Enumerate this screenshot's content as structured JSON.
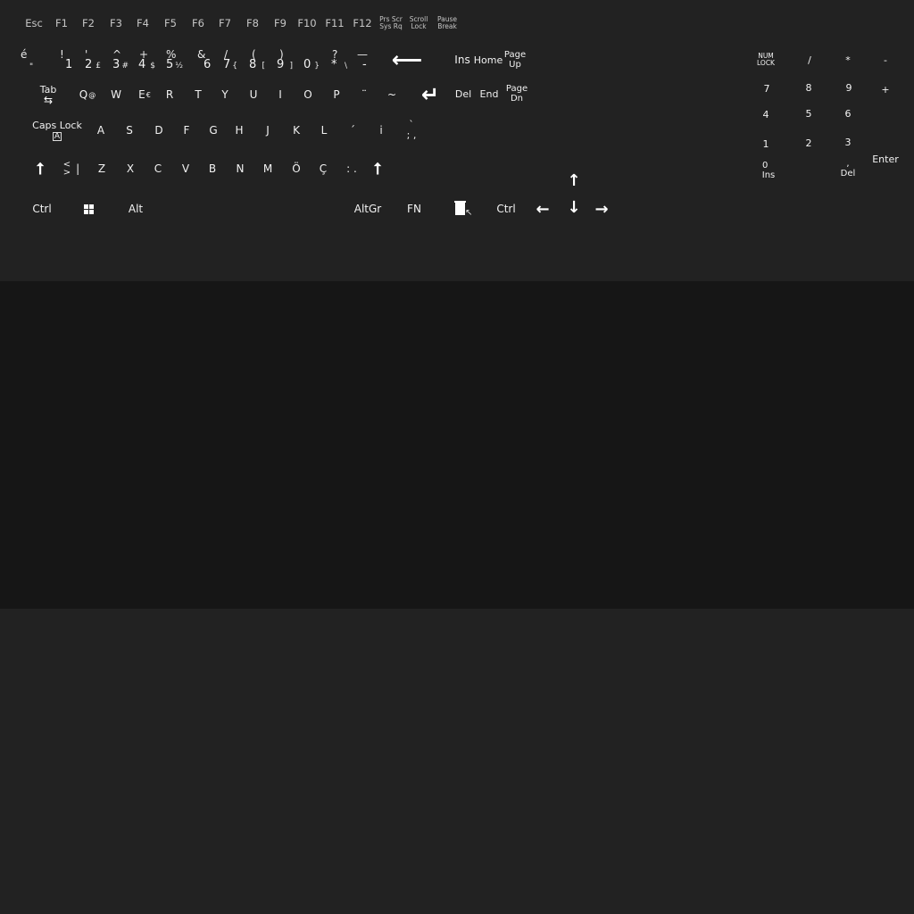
{
  "keyboard": {
    "function_row": {
      "esc": "Esc",
      "f1": "F1",
      "f2": "F2",
      "f3": "F3",
      "f4": "F4",
      "f5": "F5",
      "f6": "F6",
      "f7": "F7",
      "f8": "F8",
      "f9": "F9",
      "f10": "F10",
      "f11": "F11",
      "f12": "F12",
      "prtsc_line1": "Prs Scr",
      "prtsc_line2": "Sys Rq",
      "scroll_line1": "Scroll",
      "scroll_line2": "Lock",
      "pause_line1": "Pause",
      "pause_line2": "Break"
    },
    "number_row": [
      {
        "top": "é",
        "bottom": "\"",
        "alt": ""
      },
      {
        "top": "!",
        "bottom": "1",
        "alt": ""
      },
      {
        "top": "'",
        "bottom": "2",
        "alt": "£"
      },
      {
        "top": "^",
        "bottom": "3",
        "alt": "#"
      },
      {
        "top": "+",
        "bottom": "4",
        "alt": "$"
      },
      {
        "top": "%",
        "bottom": "5",
        "alt": "½"
      },
      {
        "top": "&",
        "bottom": "6",
        "alt": ""
      },
      {
        "top": "/",
        "bottom": "7",
        "alt": "{"
      },
      {
        "top": "(",
        "bottom": "8",
        "alt": "["
      },
      {
        "top": ")",
        "bottom": "9",
        "alt": "]"
      },
      {
        "top": "",
        "bottom": "0",
        "alt": "}"
      },
      {
        "top": "?",
        "bottom": "*",
        "alt": "\\"
      },
      {
        "top": "—",
        "bottom": "-",
        "alt": ""
      }
    ],
    "backspace_icon": "backspace-arrow",
    "nav": {
      "ins": "Ins",
      "home": "Home",
      "pageup_line1": "Page",
      "pageup_line2": "Up",
      "del": "Del",
      "end": "End",
      "pagedn_line1": "Page",
      "pagedn_line2": "Dn"
    },
    "qwerty_row": {
      "tab": "Tab",
      "keys": [
        {
          "main": "Q",
          "alt": "@"
        },
        {
          "main": "W",
          "alt": ""
        },
        {
          "main": "E",
          "alt": "€"
        },
        {
          "main": "R",
          "alt": ""
        },
        {
          "main": "T",
          "alt": ""
        },
        {
          "main": "Y",
          "alt": ""
        },
        {
          "main": "U",
          "alt": ""
        },
        {
          "main": "I",
          "alt": ""
        },
        {
          "main": "O",
          "alt": ""
        },
        {
          "main": "P",
          "alt": ""
        },
        {
          "main": "¨",
          "alt": ""
        },
        {
          "main": "~",
          "alt": ""
        }
      ]
    },
    "home_row": {
      "caps_label": "Caps Lock",
      "keys": [
        "A",
        "S",
        "D",
        "F",
        "G",
        "H",
        "J",
        "K",
        "L",
        "´",
        "i"
      ],
      "last_top": "`",
      "last_bottom": "; ,"
    },
    "shift_row": {
      "angle_top": "<",
      "angle_bottom": ">",
      "angle_side": "|",
      "keys": [
        "Z",
        "X",
        "C",
        "V",
        "B",
        "N",
        "M",
        "Ö",
        "Ç",
        ": ."
      ]
    },
    "bottom_row": {
      "ctrl_left": "Ctrl",
      "alt": "Alt",
      "altgr": "AltGr",
      "fn": "FN",
      "ctrl_right": "Ctrl"
    },
    "numpad": {
      "numlock_line1": "NUM",
      "numlock_line2": "LOCK",
      "divide": "/",
      "multiply": "*",
      "minus": "-",
      "plus": "+",
      "n7": "7",
      "n8": "8",
      "n9": "9",
      "n4": "4",
      "n5": "5",
      "n6": "6",
      "n1": "1",
      "n2": "2",
      "n3": "3",
      "n0_top": "0",
      "n0_bottom": "Ins",
      "dec_top": ",",
      "dec_bottom": "Del",
      "enter": "Enter"
    }
  },
  "colors": {
    "panel_background": "#222222",
    "middle_band": "#161616",
    "key_text": "#f2f2f2",
    "function_key_text": "#c6c6c6"
  }
}
